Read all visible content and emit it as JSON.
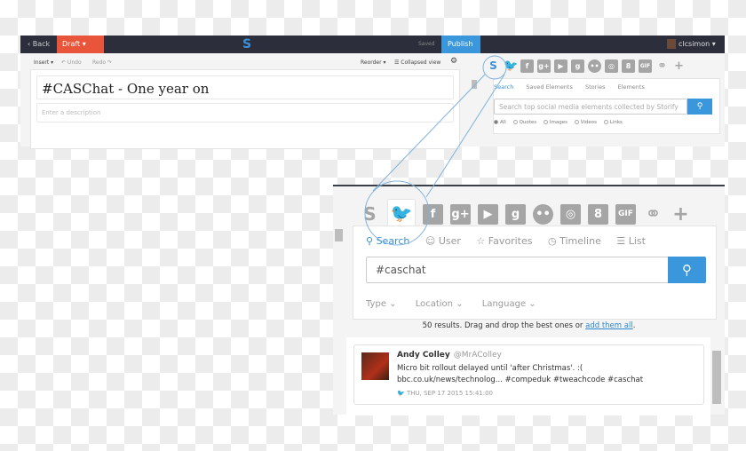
{
  "topbar": {
    "back": "‹ Back",
    "draft": "Draft ▾",
    "saved": "Saved",
    "publish": "Publish",
    "user": "clcsimon ▾"
  },
  "toolbar": {
    "insert": "Insert ▾",
    "undo": "↶ Undo",
    "redo": "Redo ↷",
    "reorder": "Reorder ▾",
    "collapsed": "☰ Collapsed view",
    "settings": "⚙"
  },
  "story": {
    "title": "#CASChat - One year on",
    "description_placeholder": "Enter a description"
  },
  "source_icons": [
    "storify",
    "twitter",
    "facebook",
    "google-plus",
    "youtube",
    "getty",
    "flickr",
    "instagram",
    "google",
    "gif",
    "link",
    "plus"
  ],
  "right_panel": {
    "tabs": [
      "Search",
      "Saved Elements",
      "Stories",
      "Elements"
    ],
    "search_placeholder": "Search top social media elements collected by Storify",
    "filters": [
      "All",
      "Quotes",
      "Images",
      "Videos",
      "Links"
    ]
  },
  "twitter_panel": {
    "tabs": [
      "Search",
      "User",
      "Favorites",
      "Timeline",
      "List"
    ],
    "query": "#caschat",
    "filters": [
      "Type ⌄",
      "Location ⌄",
      "Language ⌄"
    ],
    "results_text": "50 results. Drag and drop the best ones or ",
    "results_link": "add them all",
    "results_end": "."
  },
  "tweet": {
    "name": "Andy Colley",
    "handle": "@MrAColley",
    "line1": "Micro bit rollout delayed until 'after Christmas'. :(",
    "line2": "bbc.co.uk/news/technolog... #compeduk #tweachcode #caschat",
    "date": "THU, SEP 17 2015 15:41:00"
  },
  "colors": {
    "accent": "#3a97dc",
    "draft": "#e8553a",
    "topbar": "#2c2f3b"
  }
}
